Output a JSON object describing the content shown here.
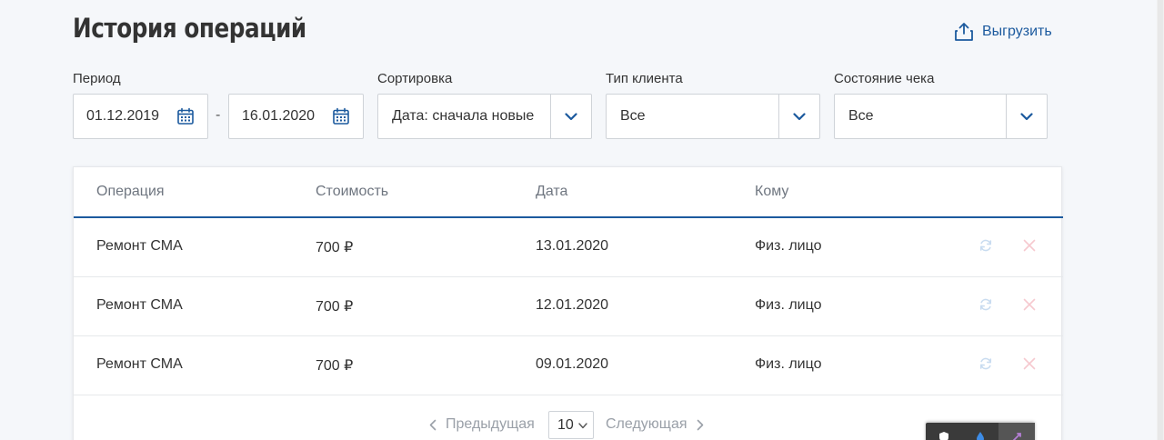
{
  "header": {
    "title": "История операций",
    "export_label": "Выгрузить"
  },
  "filters": {
    "period": {
      "label": "Период",
      "from": "01.12.2019",
      "separator": "-",
      "to": "16.01.2020"
    },
    "sort": {
      "label": "Сортировка",
      "value": "Дата: сначала новые"
    },
    "client_type": {
      "label": "Тип клиента",
      "value": "Все"
    },
    "receipt_state": {
      "label": "Состояние чека",
      "value": "Все"
    }
  },
  "table": {
    "columns": [
      "Операция",
      "Стоимость",
      "Дата",
      "Кому"
    ],
    "rows": [
      {
        "operation": "Ремонт СМА",
        "cost": "700 ₽",
        "date": "13.01.2020",
        "recipient": "Физ. лицо"
      },
      {
        "operation": "Ремонт СМА",
        "cost": "700 ₽",
        "date": "12.01.2020",
        "recipient": "Физ. лицо"
      },
      {
        "operation": "Ремонт СМА",
        "cost": "700 ₽",
        "date": "09.01.2020",
        "recipient": "Физ. лицо"
      }
    ]
  },
  "pagination": {
    "prev_label": "Предыдущая",
    "page_size": "10",
    "next_label": "Следующая"
  },
  "colors": {
    "accent": "#1c5a9e",
    "refresh_icon": "#c9dcf0",
    "cancel_icon": "#f6c9cf"
  }
}
